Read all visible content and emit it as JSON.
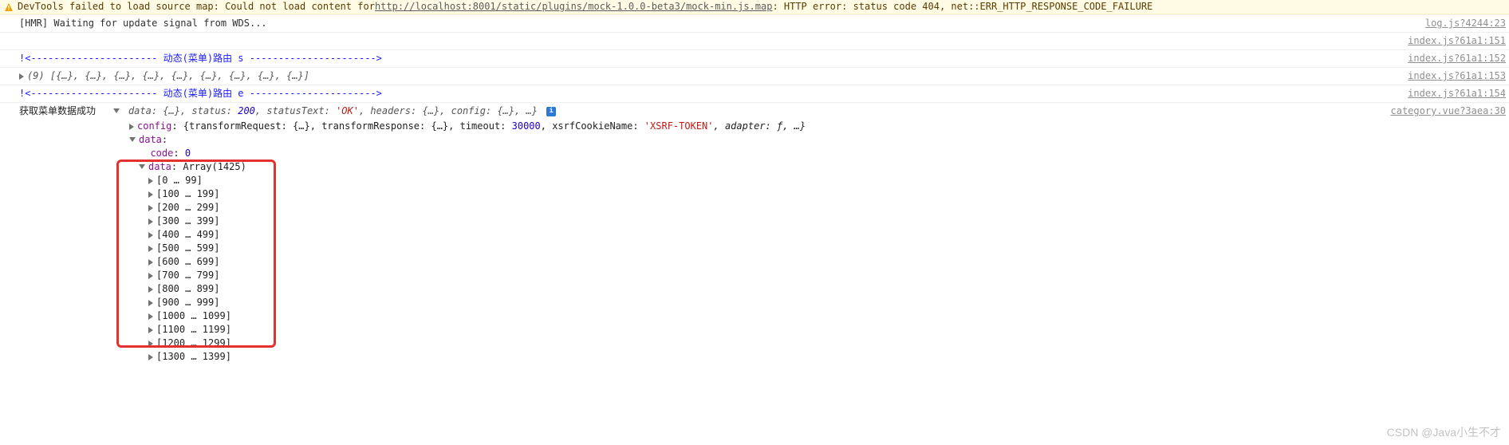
{
  "warning": {
    "prefix": "DevTools failed to load source map: Could not load content for ",
    "url": "http://localhost:8001/static/plugins/mock-1.0.0-beta3/mock-min.js.map",
    "suffix": ": HTTP error: status code 404, net::ERR_HTTP_RESPONSE_CODE_FAILURE"
  },
  "logs": [
    {
      "type": "plain",
      "text": "[HMR] Waiting for update signal from WDS...",
      "src": "log.js?4244:23"
    },
    {
      "type": "blank",
      "text": "",
      "src": "index.js?61a1:151"
    },
    {
      "type": "blue",
      "text": "!<---------------------- 动态(菜单)路由 s ---------------------->",
      "src": "index.js?61a1:152"
    },
    {
      "type": "array",
      "text": "(9) [{…}, {…}, {…}, {…}, {…}, {…}, {…}, {…}, {…}]",
      "src": "index.js?61a1:153"
    },
    {
      "type": "blue",
      "text": "!<---------------------- 动态(菜单)路由 e ---------------------->",
      "src": "index.js?61a1:154"
    }
  ],
  "objLog": {
    "label": "获取菜单数据成功",
    "summary": {
      "prefix": "{",
      "parts": [
        "data: ",
        "{…}",
        ", status: ",
        "200",
        ", statusText: ",
        "'OK'",
        ", headers: ",
        "{…}",
        ", config: ",
        "{…}",
        ", …}"
      ],
      "src": "category.vue?3aea:30"
    },
    "config_line": {
      "key": "config",
      "body": ": {transformRequest: {…}, transformResponse: {…}, timeout: ",
      "timeout": "30000",
      "mid": ", xsrfCookieName: ",
      "token": "'XSRF-TOKEN'",
      "tail": ", adapter: ƒ, …}"
    },
    "data_key": "data",
    "code_key": "code",
    "code_val": "0",
    "inner_data_key": "data",
    "inner_data_val": "Array(1425)",
    "ranges": [
      "[0 … 99]",
      "[100 … 199]",
      "[200 … 299]",
      "[300 … 399]",
      "[400 … 499]",
      "[500 … 599]",
      "[600 … 699]",
      "[700 … 799]",
      "[800 … 899]",
      "[900 … 999]",
      "[1000 … 1099]",
      "[1100 … 1199]",
      "[1200 … 1299]",
      "[1300 … 1399]"
    ]
  },
  "watermark": "CSDN @Java小生不才"
}
